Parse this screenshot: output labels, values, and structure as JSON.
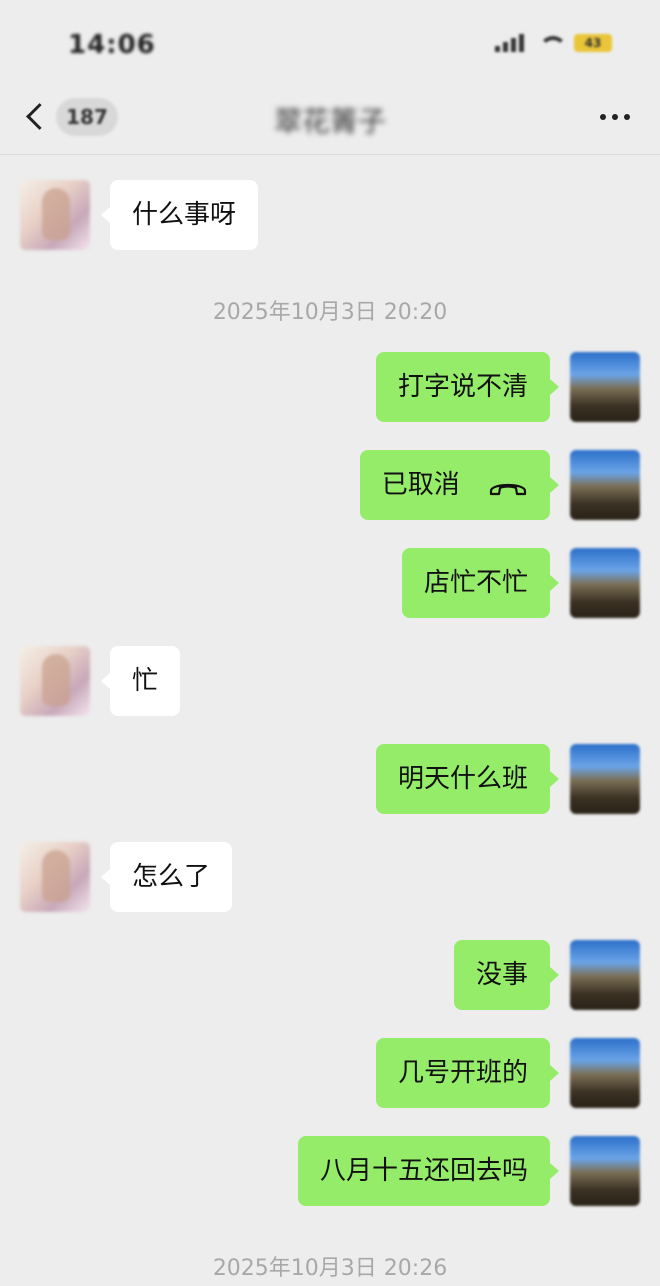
{
  "status_bar": {
    "time": "14:06",
    "battery": "43"
  },
  "nav": {
    "back_badge": "187",
    "title": "翠花箐子"
  },
  "messages": [
    {
      "text": "什么事呀"
    },
    {
      "timestamp": "2025年10月3日 20:20"
    },
    {
      "text": "打字说不清"
    },
    {
      "text": "已取消"
    },
    {
      "text": "店忙不忙"
    },
    {
      "text": "忙"
    },
    {
      "text": "明天什么班"
    },
    {
      "text": "怎么了"
    },
    {
      "text": "没事"
    },
    {
      "text": "几号开班的"
    },
    {
      "text": "八月十五还回去吗"
    },
    {
      "timestamp": "2025年10月3日 20:26"
    }
  ],
  "colors": {
    "background": "#ededed",
    "outgoing_bubble": "#95ec69",
    "incoming_bubble": "#ffffff",
    "timestamp": "#a8a8a8"
  },
  "icons": {
    "back": "chevron-left-icon",
    "more": "more-dots-icon",
    "call_cancelled": "phone-hangup-icon"
  }
}
